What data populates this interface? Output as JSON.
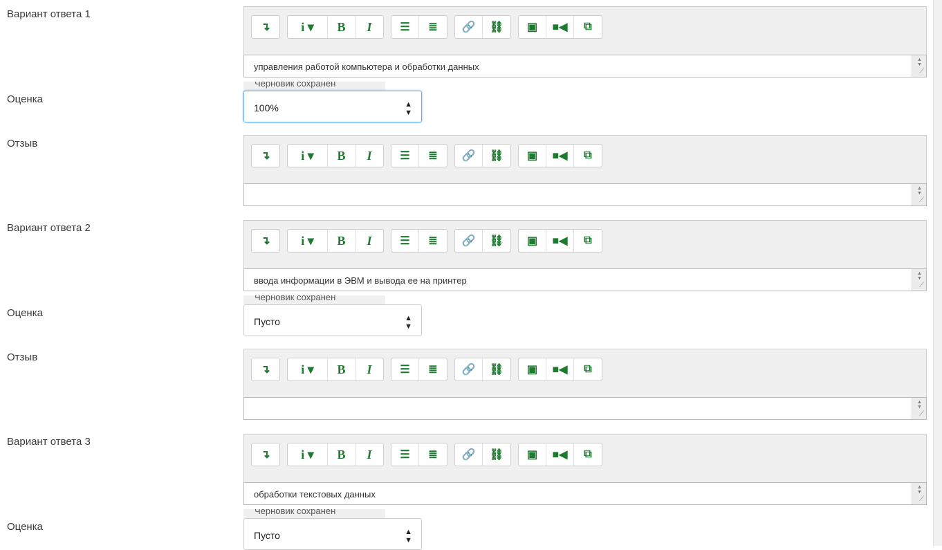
{
  "toolbar": {
    "icons": [
      "collapse-icon",
      "info-icon",
      "bold-icon",
      "italic-icon",
      "unordered-list-icon",
      "ordered-list-icon",
      "link-icon",
      "unlink-icon",
      "image-icon",
      "video-icon",
      "manage-files-icon"
    ],
    "glyphs": {
      "collapse": "↴",
      "info": "i ▾",
      "bold": "B",
      "italic": "I",
      "ul": "☰",
      "ol": "≣",
      "link": "🔗",
      "unlink": "⛓",
      "image": "▣",
      "video": "■◀",
      "files": "⧉"
    }
  },
  "answers": [
    {
      "label": "Вариант ответа 1",
      "text": "управления работой компьютера и обработки данных",
      "grade_label": "Оценка",
      "grade": "100%",
      "feedback_label": "Отзыв",
      "feedback": ""
    },
    {
      "label": "Вариант ответа 2",
      "text": "ввода информации в ЭВМ и вывода ее на принтер",
      "grade_label": "Оценка",
      "grade": "Пусто",
      "feedback_label": "Отзыв",
      "feedback": ""
    },
    {
      "label": "Вариант ответа 3",
      "text": "обработки текстовых данных",
      "grade_label": "Оценка",
      "grade": "Пусто"
    }
  ],
  "hidden_tag": "Черновик сохранен",
  "colors": {
    "accent": "#1d7a2f",
    "toolbar_bg": "#f0f0f0",
    "focus": "#66afe9"
  }
}
